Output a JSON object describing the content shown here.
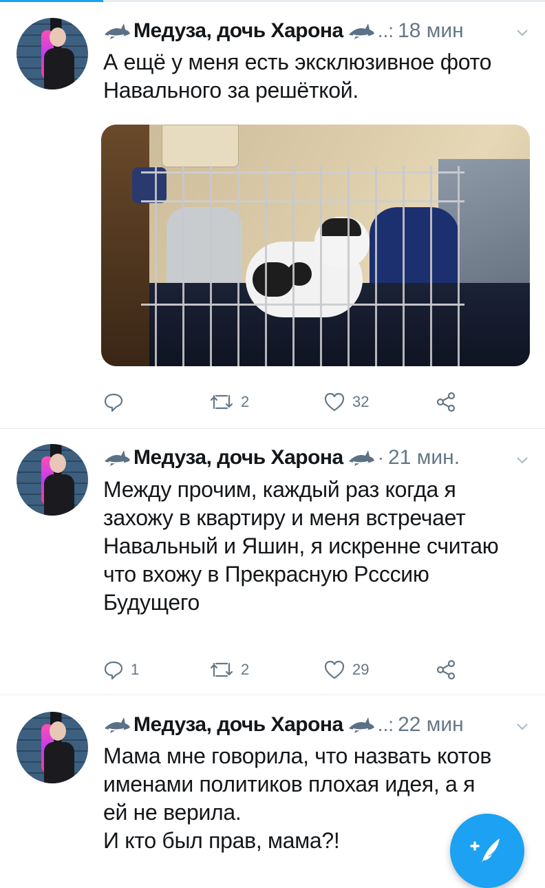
{
  "colors": {
    "accent": "#1da1f2",
    "text": "#14171a",
    "muted": "#657786",
    "divider": "#e6ecf0"
  },
  "tweets": [
    {
      "author": "Медуза, дочь Харона",
      "separator": "..:",
      "time": "18 мин",
      "text": "А ещё у меня есть эксклюзивное фото\nНавального за решёткой.",
      "has_photo": true,
      "reply_count": "",
      "retweet_count": "2",
      "like_count": "32"
    },
    {
      "author": "Медуза, дочь Харона",
      "separator": "·",
      "time": "21 мин.",
      "text": "Между прочим, каждый раз когда я\nзахожу в квартиру и меня встречает\nНавальный и Яшин, я искренне считаю\nчто вхожу в Прекрасную Рсссию\nБудущего",
      "has_photo": false,
      "reply_count": "1",
      "retweet_count": "2",
      "like_count": "29"
    },
    {
      "author": "Медуза, дочь Харона",
      "separator": "..:",
      "time": "22 мин",
      "text": "Мама мне говорила, что назвать котов\nименами политиков плохая идея, а я\nей не верила.\nИ кто был прав, мама?!",
      "has_photo": false
    }
  ],
  "icons": {
    "author_emoji": "shark-icon",
    "reply": "reply-icon",
    "retweet": "retweet-icon",
    "like": "heart-icon",
    "share": "share-icon",
    "menu": "chevron-down-icon",
    "compose": "compose-tweet-icon"
  }
}
